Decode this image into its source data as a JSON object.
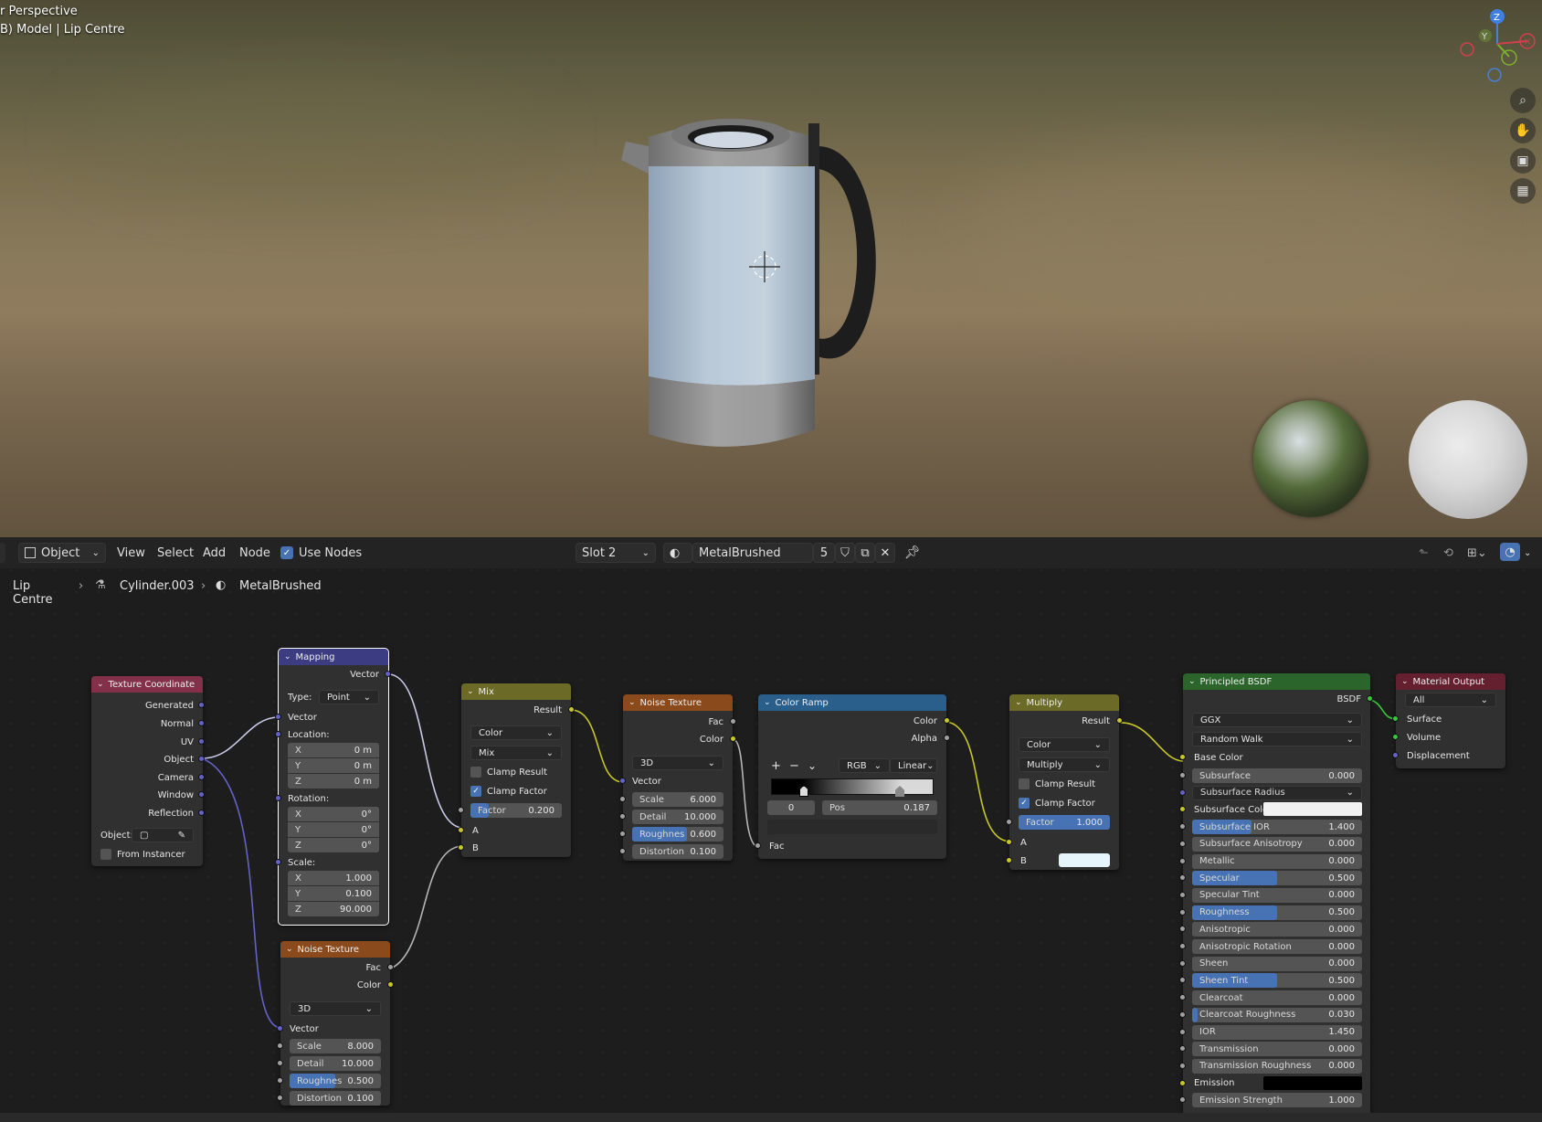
{
  "viewport": {
    "title": "r Perspective",
    "subtitle": "B) Model | Lip Centre",
    "gizmo": {
      "z": "Z",
      "y": "Y"
    }
  },
  "toolbar": {
    "mode": "Object",
    "menus": [
      "View",
      "Select",
      "Add",
      "Node"
    ],
    "use_nodes": "Use Nodes",
    "slot": "Slot 2",
    "material": "MetalBrushed",
    "users": "5"
  },
  "breadcrumb": {
    "object": "Lip Centre",
    "mesh": "Cylinder.003",
    "material": "MetalBrushed"
  },
  "nodes": {
    "texcoord": {
      "title": "Texture Coordinate",
      "outputs": [
        "Generated",
        "Normal",
        "UV",
        "Object",
        "Camera",
        "Window",
        "Reflection"
      ],
      "object_label": "Object:",
      "from_instancer": "From Instancer"
    },
    "mapping": {
      "title": "Mapping",
      "out": "Vector",
      "type_label": "Type:",
      "type": "Point",
      "vector": "Vector",
      "location": "Location:",
      "rotation": "Rotation:",
      "scale": "Scale:",
      "loc": [
        {
          "a": "X",
          "v": "0 m"
        },
        {
          "a": "Y",
          "v": "0 m"
        },
        {
          "a": "Z",
          "v": "0 m"
        }
      ],
      "rot": [
        {
          "a": "X",
          "v": "0°"
        },
        {
          "a": "Y",
          "v": "0°"
        },
        {
          "a": "Z",
          "v": "0°"
        }
      ],
      "scl": [
        {
          "a": "X",
          "v": "1.000"
        },
        {
          "a": "Y",
          "v": "0.100"
        },
        {
          "a": "Z",
          "v": "90.000"
        }
      ]
    },
    "noise2": {
      "title": "Noise Texture",
      "fac": "Fac",
      "color": "Color",
      "dim": "3D",
      "vector": "Vector",
      "scale_l": "Scale",
      "scale": "8.000",
      "detail_l": "Detail",
      "detail": "10.000",
      "rough_l": "Roughnes",
      "rough": "0.500",
      "rough_frac": 0.5,
      "dist_l": "Distortion",
      "dist": "0.100"
    },
    "mix": {
      "title": "Mix",
      "result": "Result",
      "dt": "Color",
      "blend": "Mix",
      "clamp_result": "Clamp Result",
      "clamp_factor": "Clamp Factor",
      "factor_l": "Factor",
      "factor": "0.200",
      "factor_frac": 0.2,
      "a": "A",
      "b": "B"
    },
    "noise1": {
      "title": "Noise Texture",
      "fac": "Fac",
      "color": "Color",
      "dim": "3D",
      "vector": "Vector",
      "scale_l": "Scale",
      "scale": "6.000",
      "detail_l": "Detail",
      "detail": "10.000",
      "rough_l": "Roughnes",
      "rough": "0.600",
      "rough_frac": 0.6,
      "dist_l": "Distortion",
      "dist": "0.100"
    },
    "ramp": {
      "title": "Color Ramp",
      "color": "Color",
      "alpha": "Alpha",
      "plus": "+",
      "minus": "−",
      "chev": "⌄",
      "mode": "RGB",
      "interp": "Linear",
      "index": "0",
      "pos_l": "Pos",
      "pos": "0.187",
      "fac": "Fac"
    },
    "multiply": {
      "title": "Multiply",
      "result": "Result",
      "dt": "Color",
      "blend": "Multiply",
      "clamp_result": "Clamp Result",
      "clamp_factor": "Clamp Factor",
      "factor_l": "Factor",
      "factor": "1.000",
      "factor_frac": 1.0,
      "a": "A",
      "b": "B"
    },
    "bsdf": {
      "title": "Principled BSDF",
      "out": "BSDF",
      "dist": "GGX",
      "ss_method": "Random Walk",
      "base_color": "Base Color",
      "rows": [
        {
          "l": "Subsurface",
          "v": "0.000",
          "f": 0,
          "s": "fl"
        },
        {
          "l": "Subsurface Radius",
          "v": "",
          "f": 0,
          "s": "vec",
          "dd": true
        },
        {
          "l": "Subsurface Color",
          "v": "",
          "f": 0,
          "s": "col",
          "sw": "#f2f2f2"
        },
        {
          "l": "Subsurface IOR",
          "v": "1.400",
          "f": 0.35,
          "s": "fl"
        },
        {
          "l": "Subsurface Anisotropy",
          "v": "0.000",
          "f": 0,
          "s": "fl"
        },
        {
          "l": "Metallic",
          "v": "0.000",
          "f": 0,
          "s": "fl"
        },
        {
          "l": "Specular",
          "v": "0.500",
          "f": 0.5,
          "s": "fl"
        },
        {
          "l": "Specular Tint",
          "v": "0.000",
          "f": 0,
          "s": "fl"
        },
        {
          "l": "Roughness",
          "v": "0.500",
          "f": 0.5,
          "s": "fl"
        },
        {
          "l": "Anisotropic",
          "v": "0.000",
          "f": 0,
          "s": "fl"
        },
        {
          "l": "Anisotropic Rotation",
          "v": "0.000",
          "f": 0,
          "s": "fl"
        },
        {
          "l": "Sheen",
          "v": "0.000",
          "f": 0,
          "s": "fl"
        },
        {
          "l": "Sheen Tint",
          "v": "0.500",
          "f": 0.5,
          "s": "fl"
        },
        {
          "l": "Clearcoat",
          "v": "0.000",
          "f": 0,
          "s": "fl"
        },
        {
          "l": "Clearcoat Roughness",
          "v": "0.030",
          "f": 0.03,
          "s": "fl"
        },
        {
          "l": "IOR",
          "v": "1.450",
          "f": 0,
          "s": "fl"
        },
        {
          "l": "Transmission",
          "v": "0.000",
          "f": 0,
          "s": "fl"
        },
        {
          "l": "Transmission Roughness",
          "v": "0.000",
          "f": 0,
          "s": "fl"
        },
        {
          "l": "Emission",
          "v": "",
          "f": 0,
          "s": "col",
          "sw": "#000000"
        },
        {
          "l": "Emission Strength",
          "v": "1.000",
          "f": 0,
          "s": "fl"
        }
      ]
    },
    "output": {
      "title": "Material Output",
      "target": "All",
      "surface": "Surface",
      "volume": "Volume",
      "displacement": "Displacement"
    }
  },
  "colors": {
    "accent": "#4772b3",
    "hd_texcoord": "#83314a",
    "hd_mapping": "#3c3c83",
    "hd_noise": "#8a4a1c",
    "hd_mix": "#6b6a26",
    "hd_ramp": "#2a5f8c",
    "hd_bsdf": "#2b652b",
    "hd_output": "#652030"
  }
}
